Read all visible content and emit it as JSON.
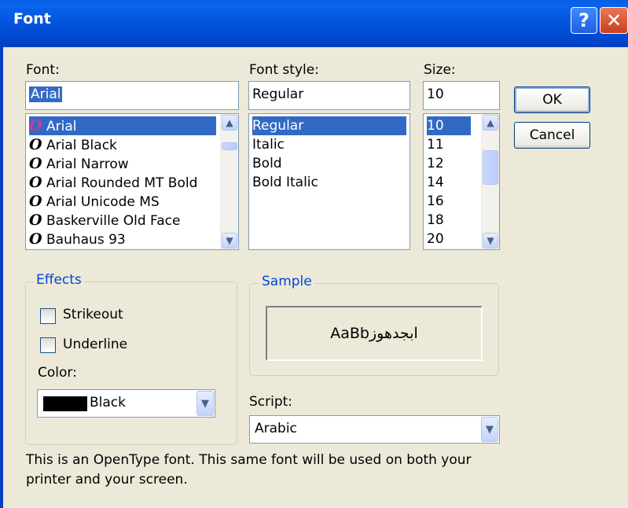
{
  "window": {
    "title": "Font",
    "help_glyph": "?",
    "close_glyph": "✕"
  },
  "font": {
    "label": "Font:",
    "value": "Arial",
    "items": [
      "Arial",
      "Arial Black",
      "Arial Narrow",
      "Arial Rounded MT Bold",
      "Arial Unicode MS",
      "Baskerville Old Face",
      "Bauhaus 93"
    ],
    "item_glyph": "O",
    "selected_index": 0
  },
  "style": {
    "label": "Font style:",
    "value": "Regular",
    "items": [
      "Regular",
      "Italic",
      "Bold",
      "Bold Italic"
    ],
    "selected_index": 0
  },
  "size": {
    "label": "Size:",
    "value": "10",
    "items": [
      "10",
      "11",
      "12",
      "14",
      "16",
      "18",
      "20"
    ],
    "selected_index": 0
  },
  "buttons": {
    "ok": "OK",
    "cancel": "Cancel"
  },
  "effects": {
    "legend": "Effects",
    "strikeout": "Strikeout",
    "underline": "Underline",
    "strikeout_checked": false,
    "underline_checked": false,
    "color_label": "Color:",
    "color_value": "Black",
    "color_swatch": "#000000"
  },
  "sample": {
    "legend": "Sample",
    "text": "AaBbابجدهوز"
  },
  "script": {
    "label": "Script:",
    "value": "Arabic"
  },
  "info": {
    "line1": "This is an OpenType font. This same font will be used on both your",
    "line2": "printer and your screen."
  },
  "icons": {
    "scroll_up": "▲",
    "scroll_down": "▼",
    "dropdown": "▼"
  }
}
